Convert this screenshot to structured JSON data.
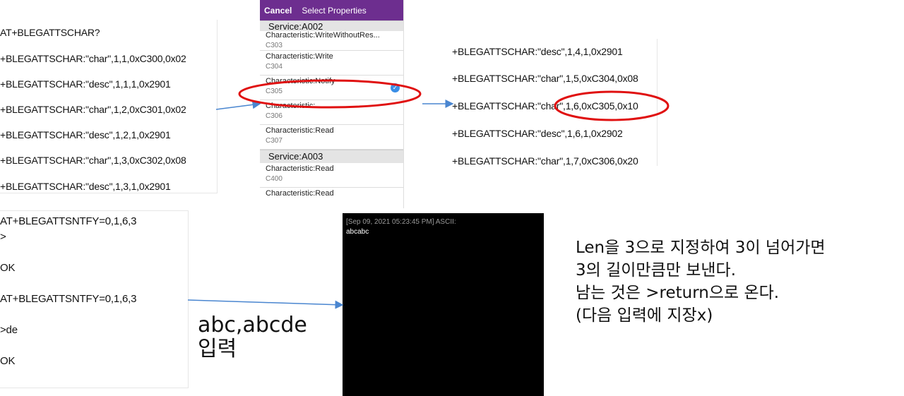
{
  "top_left_terminal": {
    "lines": [
      "AT+BLEGATTSCHAR?",
      "+BLEGATTSCHAR:\"char\",1,1,0xC300,0x02",
      "+BLEGATTSCHAR:\"desc\",1,1,1,0x2901",
      "+BLEGATTSCHAR:\"char\",1,2,0xC301,0x02",
      "+BLEGATTSCHAR:\"desc\",1,2,1,0x2901",
      "+BLEGATTSCHAR:\"char\",1,3,0xC302,0x08",
      "+BLEGATTSCHAR:\"desc\",1,3,1,0x2901"
    ]
  },
  "phone": {
    "cancel": "Cancel",
    "title": "Select Properties",
    "service_a002": "Service:A002",
    "rows_a002": [
      {
        "title": "Characteristic:WriteWithoutRes...",
        "uuid": "C303"
      },
      {
        "title": "Characteristic:Write",
        "uuid": "C304"
      },
      {
        "title": "Characteristic:Notify",
        "uuid": "C305",
        "checked": "✓"
      },
      {
        "title": "Characteristic:",
        "uuid": "C306"
      },
      {
        "title": "Characteristic:Read",
        "uuid": "C307"
      }
    ],
    "service_a003": "Service:A003",
    "rows_a003": [
      {
        "title": "Characteristic:Read",
        "uuid": "C400"
      },
      {
        "title": "Characteristic:Read",
        "uuid": ""
      }
    ]
  },
  "top_right_terminal": {
    "lines": [
      "+BLEGATTSCHAR:\"desc\",1,4,1,0x2901",
      "+BLEGATTSCHAR:\"char\",1,5,0xC304,0x08",
      "+BLEGATTSCHAR:\"char\",1,6,0xC305,0x10",
      "+BLEGATTSCHAR:\"desc\",1,6,1,0x2902",
      "+BLEGATTSCHAR:\"char\",1,7,0xC306,0x20"
    ]
  },
  "bottom_left_terminal": {
    "lines": [
      "AT+BLEGATTSNTFY=0,1,6,3",
      ">",
      "OK",
      "AT+BLEGATTSNTFY=0,1,6,3",
      ">de",
      "OK"
    ]
  },
  "console": {
    "timestamp": "[Sep 09, 2021 05:23:45 PM] ASCII:",
    "message": "abcabc"
  },
  "input_label": {
    "line1": "abc,abcde",
    "line2": "입력"
  },
  "note": {
    "lines": [
      "Len을 3으로 지정하여 3이 넘어가면",
      "3의 길이만큼만 보낸다.",
      "남는 것은 >return으로 온다.",
      "(다음 입력에 지장x)"
    ]
  },
  "colors": {
    "header_purple": "#6d2e8f",
    "highlight_red": "#e01010",
    "arrow_blue": "#4a86d0",
    "check_blue": "#3a8ee6"
  }
}
